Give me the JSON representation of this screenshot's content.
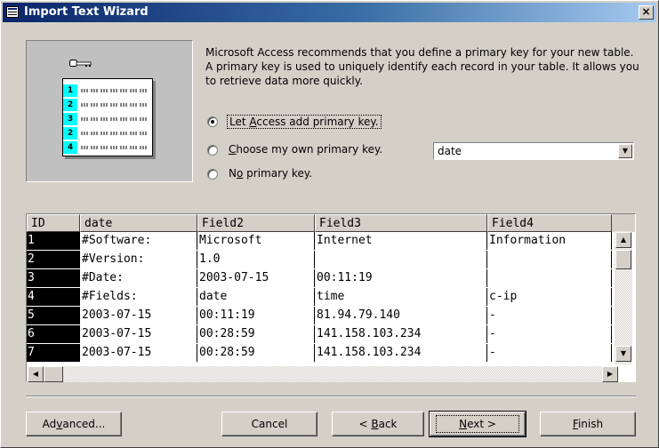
{
  "window": {
    "title": "Import Text Wizard",
    "close_label": "×"
  },
  "description": "Microsoft Access recommends that you define a primary key for your new table. A primary key is used to uniquely identify each record in your table. It allows you to retrieve data more quickly.",
  "illustration": {
    "rows": [
      "1",
      "2",
      "3",
      "2",
      "4"
    ]
  },
  "radio_options": [
    {
      "label": "Let Access add primary key.",
      "accel": "A",
      "checked": true
    },
    {
      "label": "Choose my own primary key.",
      "accel": "C",
      "checked": false
    },
    {
      "label": "No primary key.",
      "accel": "o",
      "checked": false
    }
  ],
  "primary_key_select": {
    "value": "date"
  },
  "grid": {
    "columns": [
      "ID",
      "date",
      "Field2",
      "Field3",
      "Field4"
    ],
    "rows": [
      [
        "1",
        "#Software:",
        "Microsoft",
        "Internet",
        "Information"
      ],
      [
        "2",
        "#Version:",
        "1.0",
        "",
        ""
      ],
      [
        "3",
        "#Date:",
        "2003-07-15",
        "00:11:19",
        ""
      ],
      [
        "4",
        "#Fields:",
        "date",
        "time",
        "c-ip"
      ],
      [
        "5",
        "2003-07-15",
        "00:11:19",
        "81.94.79.140",
        "-"
      ],
      [
        "6",
        "2003-07-15",
        "00:28:59",
        "141.158.103.234",
        "-"
      ],
      [
        "7",
        "2003-07-15",
        "00:28:59",
        "141.158.103.234",
        "-"
      ]
    ]
  },
  "buttons": {
    "advanced": "Advanced...",
    "cancel": "Cancel",
    "back": "< Back",
    "next": "Next >",
    "finish": "Finish"
  }
}
